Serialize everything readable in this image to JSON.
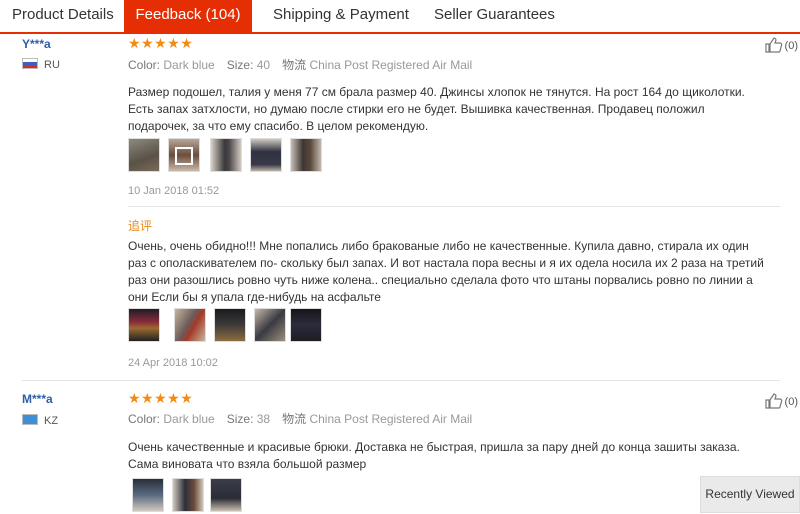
{
  "tabs": [
    {
      "label": "Product Details"
    },
    {
      "label": "Feedback (104)"
    },
    {
      "label": "Shipping & Payment"
    },
    {
      "label": "Seller Guarantees"
    }
  ],
  "reviews": [
    {
      "user": "Y***a",
      "country": "RU",
      "stars": "★★★★★",
      "color_label": "Color:",
      "color": "Dark blue",
      "size_label": "Size:",
      "size": "40",
      "ship_label": "物流",
      "shipping": "China Post Registered Air Mail",
      "text": "Размер подошел, талия у меня 77 см брала размер 40. Джинсы хлопок не тянутся. На рост 164 до щиколотки. Есть запах затхлости, но думаю после стирки его не будет. Вышивка качественная. Продавец положил подарочек, за что ему спасибо. В целом рекомендую.",
      "date": "10 Jan 2018 01:52",
      "likes": "(0)",
      "additional_label": "追评",
      "additional_text": "Очень, очень обидно!!! Мне попались либо бракованые либо не качественные. Купила давно, стирала их один раз с ополаскивателем по- скольку был запах. И вот настала пора весны и я их одела носила их 2 раза на третий раз они разошлись ровно чуть ниже колена.. специально сделала фото что штаны порвались ровно по линии а они Если бы я упала где-нибудь на асфальте",
      "additional_date": "24 Apr 2018 10:02"
    },
    {
      "user": "M***a",
      "country": "KZ",
      "stars": "★★★★★",
      "color_label": "Color:",
      "color": "Dark blue",
      "size_label": "Size:",
      "size": "38",
      "ship_label": "物流",
      "shipping": "China Post Registered Air Mail",
      "text": "Очень качественные и красивые брюки. Доставка не быстрая, пришла за пару дней до конца зашиты заказа. Сама виновата что взяла большой размер",
      "likes": "(0)"
    }
  ],
  "recently_viewed": "Recently Viewed",
  "colors": {
    "accent": "#e62e04",
    "star": "#f38a12",
    "username": "#2f5da8",
    "additional": "#e88a1a"
  }
}
